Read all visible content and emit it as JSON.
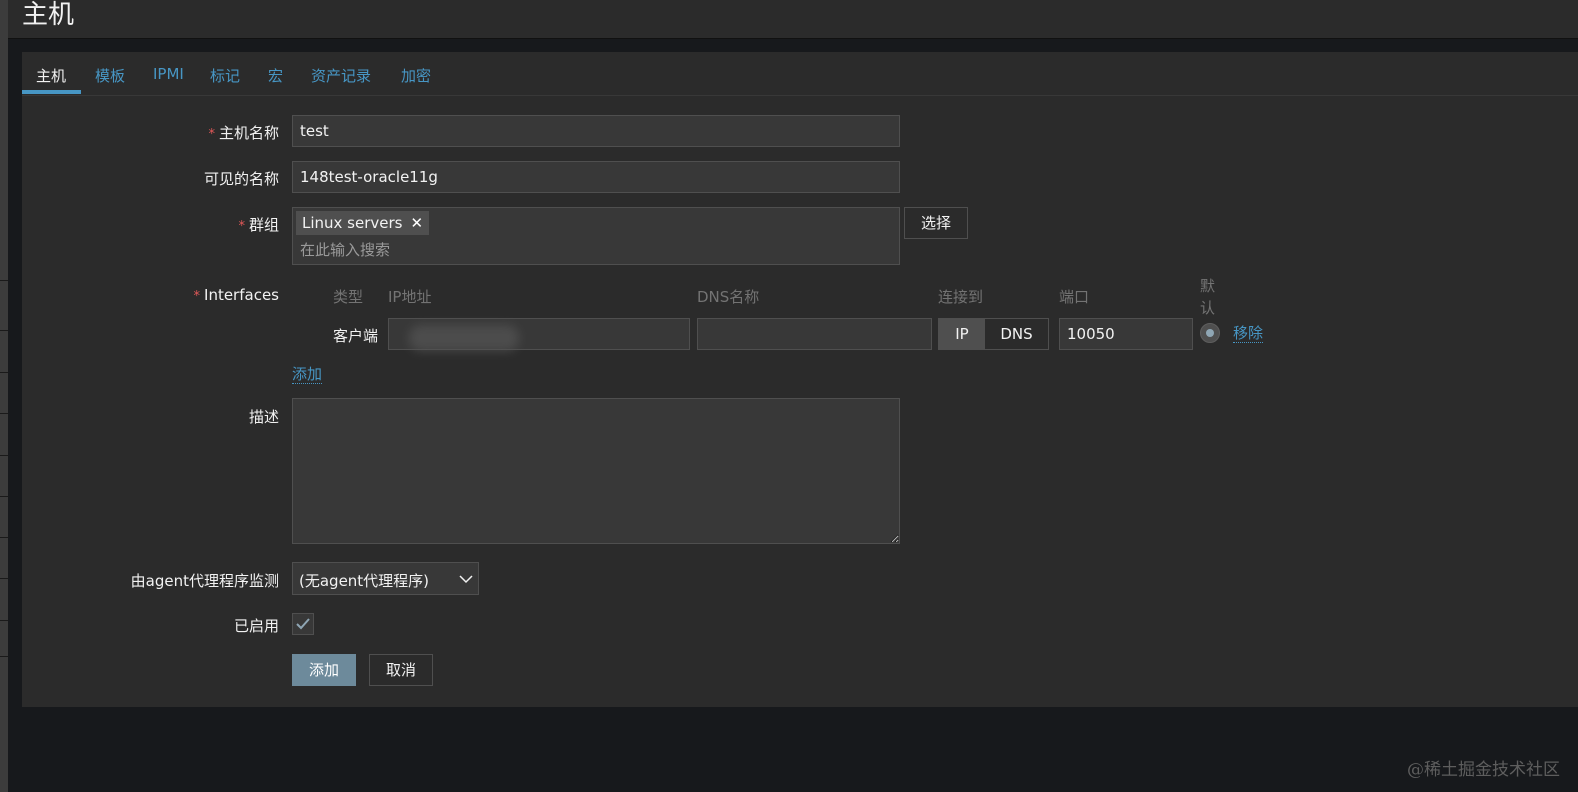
{
  "page_title": "主机",
  "tabs": [
    {
      "label": "主机"
    },
    {
      "label": "模板"
    },
    {
      "label": "IPMI"
    },
    {
      "label": "标记"
    },
    {
      "label": "宏"
    },
    {
      "label": "资产记录"
    },
    {
      "label": "加密"
    }
  ],
  "form": {
    "host_name_label": "主机名称",
    "host_name_value": "test",
    "visible_name_label": "可见的名称",
    "visible_name_value": "148test-oracle11g",
    "groups_label": "群组",
    "group_chip": "Linux servers",
    "group_remove_icon": "close-icon",
    "group_search_placeholder": "在此输入搜索",
    "select_button": "选择",
    "interfaces_label": "Interfaces",
    "iface_headers": {
      "type": "类型",
      "ip": "IP地址",
      "dns": "DNS名称",
      "connect": "连接到",
      "port": "端口",
      "default": "默认"
    },
    "iface_row": {
      "type": "客户端",
      "ip": "",
      "dns": "",
      "connect_ip": "IP",
      "connect_dns": "DNS",
      "connect_selected": "IP",
      "port": "10050",
      "remove": "移除"
    },
    "add_interface_link": "添加",
    "description_label": "描述",
    "description_value": "",
    "proxy_label": "由agent代理程序监测",
    "proxy_value": "(无agent代理程序)",
    "enabled_label": "已启用",
    "enabled_checked": true,
    "add_button": "添加",
    "cancel_button": "取消"
  },
  "watermark": "@稀土掘金技术社区",
  "colors": {
    "accent": "#4796c4",
    "background": "#2b2b2b",
    "page_background": "#17191c",
    "required": "#e45959",
    "primary_button": "#6d8a9b"
  }
}
